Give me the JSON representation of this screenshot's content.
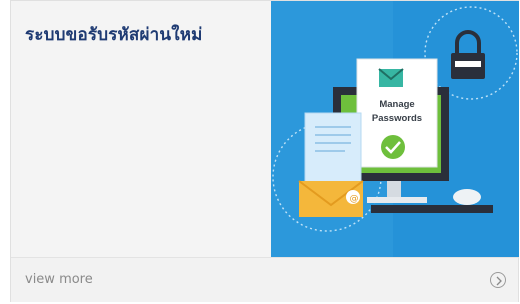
{
  "card": {
    "title": "ระบบขอรับรหัสผ่านใหม่",
    "illustration": {
      "screen_heading": "Manage",
      "screen_subheading": "Passwords",
      "icons": [
        "envelope-icon",
        "checkmark-icon",
        "padlock-icon",
        "document-icon",
        "mail-envelope-icon",
        "mouse-icon"
      ]
    },
    "footer": {
      "link_label": "view more",
      "arrow_icon": "circle-chevron-right-icon"
    }
  },
  "colors": {
    "title": "#1f3b73",
    "illustration_bg": "#1f8fd6",
    "check": "#6ab43e",
    "envelope": "#f4b73b"
  }
}
